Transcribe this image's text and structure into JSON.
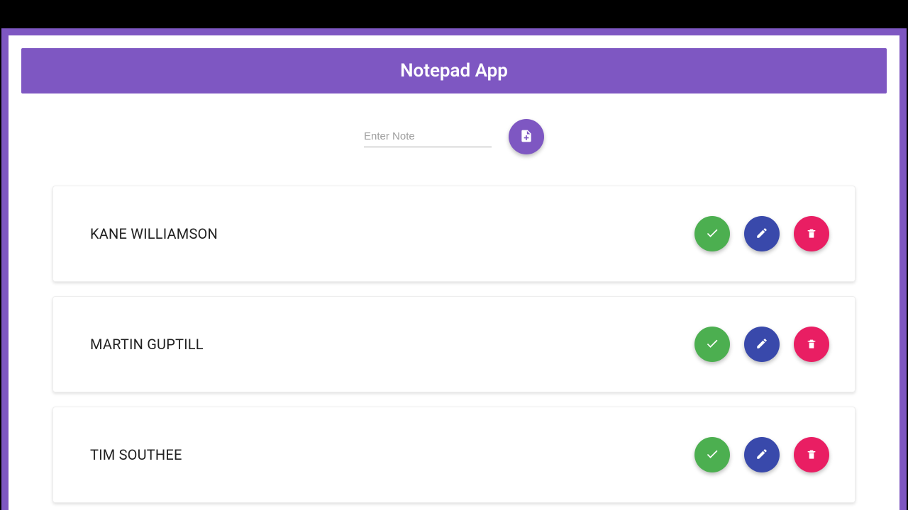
{
  "colors": {
    "primary": "#7e57c2",
    "complete": "#4caf50",
    "edit": "#3949ab",
    "delete": "#e91e63"
  },
  "header": {
    "title": "Notepad App"
  },
  "input": {
    "placeholder": "Enter Note",
    "value": ""
  },
  "icons": {
    "add": "note-add-icon",
    "complete": "check-icon",
    "edit": "pencil-icon",
    "delete": "trash-icon"
  },
  "notes": [
    {
      "text": "KANE WILLIAMSON"
    },
    {
      "text": "MARTIN GUPTILL"
    },
    {
      "text": "TIM SOUTHEE"
    }
  ]
}
